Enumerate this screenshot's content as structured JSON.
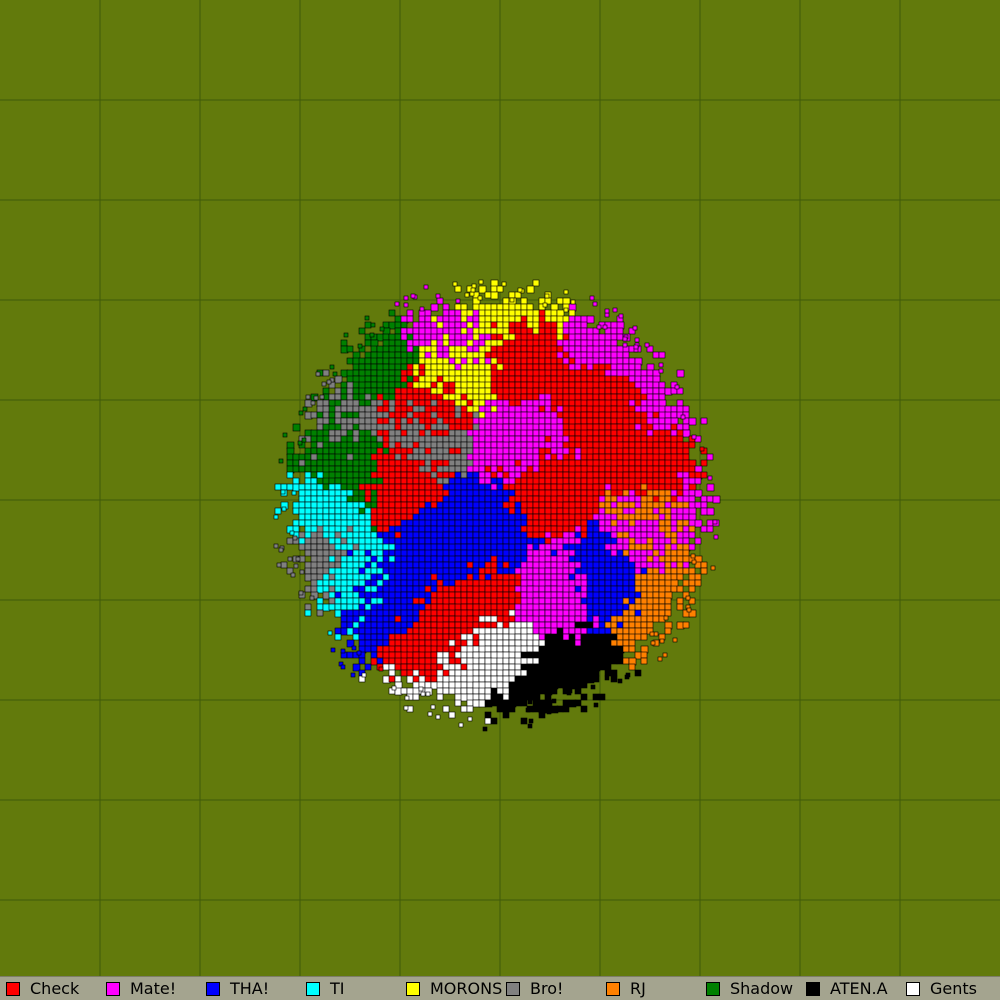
{
  "map": {
    "background_color": "#627a0c",
    "grid_color": "#3f5a0a"
  },
  "tribes": [
    {
      "name": "Check",
      "color": "#ff0000"
    },
    {
      "name": "Mate!",
      "color": "#ff00ff"
    },
    {
      "name": "THA!",
      "color": "#0000ff"
    },
    {
      "name": "TI",
      "color": "#00ffff"
    },
    {
      "name": "MORONS",
      "color": "#ffff00"
    },
    {
      "name": "Bro!",
      "color": "#808080"
    },
    {
      "name": "RJ",
      "color": "#ff8000"
    },
    {
      "name": "Shadow",
      "color": "#008000"
    },
    {
      "name": "ATEN.A",
      "color": "#000000"
    },
    {
      "name": "Gents",
      "color": "#ffffff"
    }
  ]
}
